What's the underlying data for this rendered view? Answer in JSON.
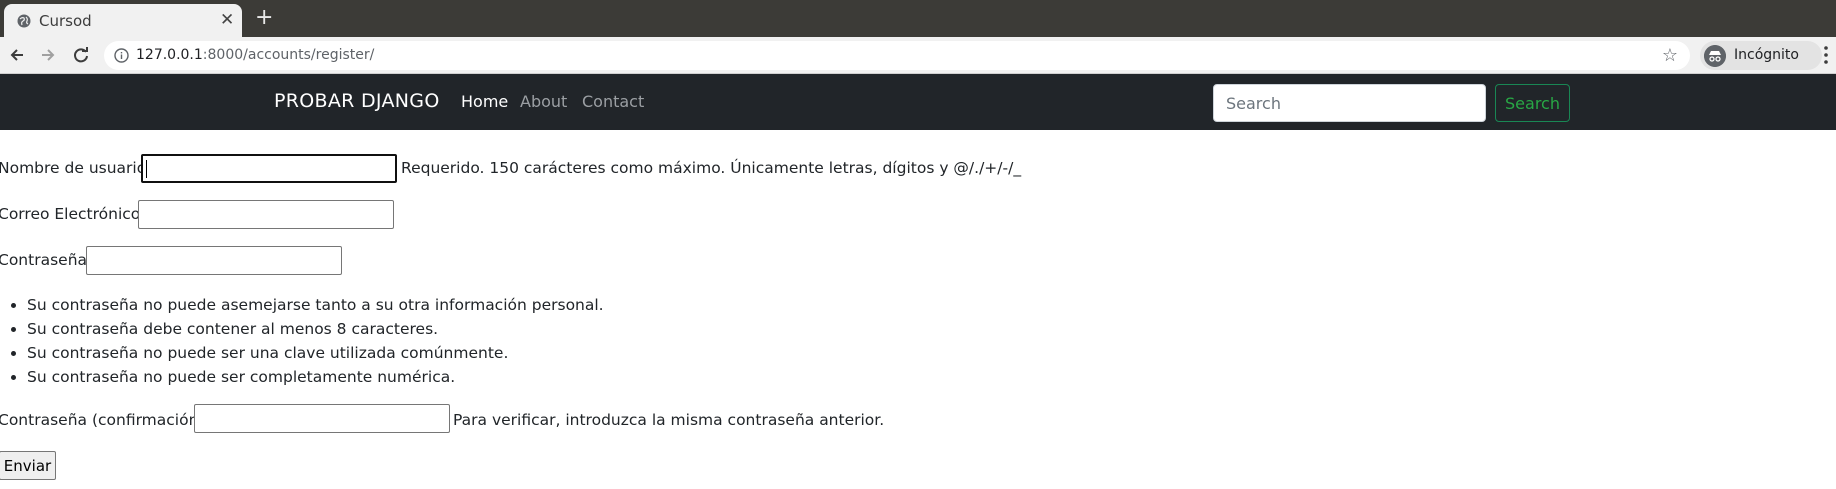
{
  "browser": {
    "tab_title": "Cursod",
    "url_host": "127.0.0.1",
    "url_rest": ":8000/accounts/register/",
    "incognito_label": "Incógnito",
    "icons": [
      "globe-icon",
      "close-icon",
      "plus-icon",
      "back-icon",
      "forward-icon",
      "reload-icon",
      "info-icon",
      "star-icon",
      "incognito-icon",
      "kebab-menu-icon"
    ]
  },
  "navbar": {
    "brand": "PROBAR DJANGO",
    "links": [
      "Home",
      "About",
      "Contact"
    ],
    "search_placeholder": "Search",
    "search_button": "Search"
  },
  "form": {
    "username_label": "Nombre de usuario:",
    "username_help": "Requerido. 150 carácteres como máximo. Únicamente letras, dígitos y @/./+/-/_",
    "email_label": "Correo Electrónico:",
    "password_label": "Contraseña:",
    "password_rules": [
      "Su contraseña no puede asemejarse tanto a su otra información personal.",
      "Su contraseña debe contener al menos 8 caracteres.",
      "Su contraseña no puede ser una clave utilizada comúnmente.",
      "Su contraseña no puede ser completamente numérica."
    ],
    "confirm_label": "Contraseña (confirmación):",
    "confirm_help": "Para verificar, introduzca la misma contraseña anterior.",
    "submit_label": "Enviar"
  }
}
